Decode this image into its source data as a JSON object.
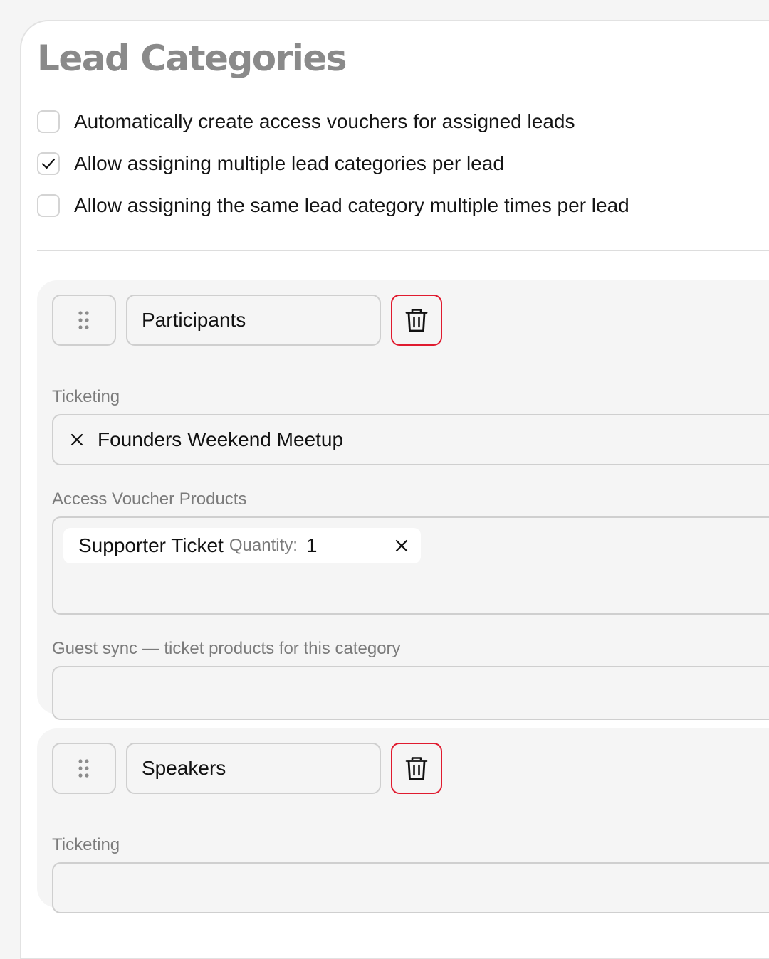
{
  "title": "Lead Categories",
  "options": [
    {
      "label": "Automatically create access vouchers for assigned leads",
      "checked": false
    },
    {
      "label": "Allow assigning multiple lead categories per lead",
      "checked": true
    },
    {
      "label": "Allow assigning the same lead category multiple times per lead",
      "checked": false
    }
  ],
  "categories": [
    {
      "name": "Participants",
      "ticketing_label": "Ticketing",
      "ticketing_value": "Founders Weekend Meetup",
      "voucher_label": "Access Voucher Products",
      "voucher_product": "Supporter Ticket",
      "quantity_label": "Quantity:",
      "quantity_value": "1",
      "guest_sync_label": "Guest sync — ticket products for this category"
    },
    {
      "name": "Speakers",
      "ticketing_label": "Ticketing"
    }
  ],
  "icons": {
    "drag": "drag-handle-icon",
    "delete": "trash-icon",
    "remove": "close-icon",
    "check": "checkmark-icon"
  },
  "colors": {
    "danger": "#e01b2f",
    "title": "#8a8a8a",
    "muted_label": "#7b7b7b"
  }
}
